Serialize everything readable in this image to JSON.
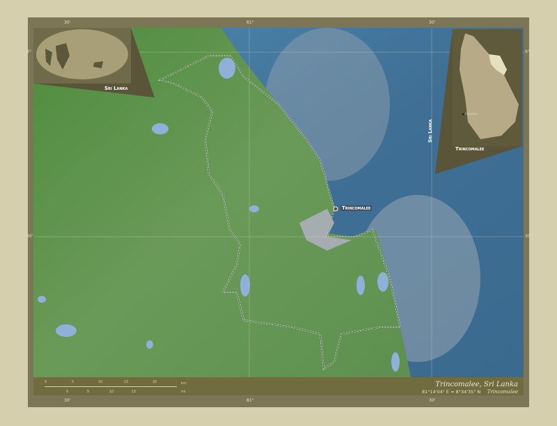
{
  "map": {
    "title": "Trincomalee, Sri Lanka",
    "subtitle": "Trincomalee",
    "coordinates": "81°14'04\" E  ≈  8°34'35\" N",
    "city_label": "Trincomalee",
    "colors": {
      "land": "#5f8f4a",
      "water": "#4a7a9e",
      "frame": "#7d7656",
      "page": "#d6cfae"
    }
  },
  "grid": {
    "top": [
      "30'",
      "81°",
      "30'"
    ],
    "bottom": [
      "30'",
      "81°",
      "30'"
    ],
    "left": [
      "9°",
      "30'"
    ],
    "right": [
      "9°",
      "30'"
    ]
  },
  "inset_world": {
    "label": "Sri Lanka"
  },
  "inset_country": {
    "label_vertical": "Sri Lanka",
    "label_region": "Trincomalee",
    "capital": "Colombo"
  },
  "scale": {
    "km_ticks": [
      "0",
      "5",
      "10",
      "15",
      "20"
    ],
    "km_unit": "km",
    "mi_ticks": [
      "0",
      "5",
      "10",
      "15"
    ],
    "mi_unit": "mi"
  }
}
